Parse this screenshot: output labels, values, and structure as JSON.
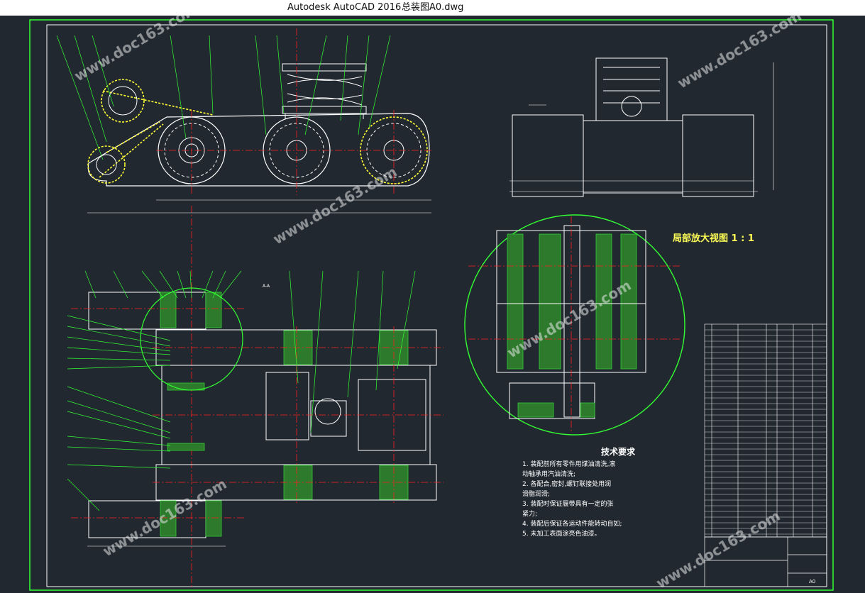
{
  "window": {
    "app_title": "Autodesk AutoCAD 2016",
    "file_name": "总装图A0.dwg"
  },
  "drawing": {
    "detail_view_title": "局部放大视图  1 : 1",
    "section_label": "A-A",
    "technical_requirements": {
      "heading": "技术要求",
      "lines": [
        "1. 装配前所有零件用煤油清洗,滚",
        "   动轴承用汽油清洗;",
        "2. 各配合,密封,螺钉联接处用润",
        "   滑脂润滑;",
        "3. 装配时保证履带具有一定的张",
        "   紧力;",
        "4. 装配后保证各运动件能转动自如;",
        "5. 未加工表面涂亮色油漆。"
      ]
    },
    "title_block": {
      "sheet_size": "A0"
    }
  },
  "watermark": {
    "text": "www.doc163.com"
  },
  "colors": {
    "background": "#212830",
    "outline": "#ffffff",
    "center_line": "#ff2020",
    "leader": "#33ff33",
    "highlight": "#ffff33",
    "hatch": "#33cc33"
  }
}
